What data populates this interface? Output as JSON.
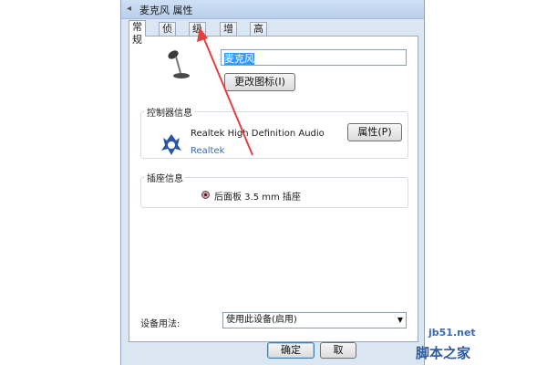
{
  "window": {
    "title": "麦克风 属性"
  },
  "tabs": [
    "常规",
    "侦听",
    "级别",
    "增强",
    "高级"
  ],
  "general": {
    "device_name": "麦克风",
    "change_icon_button": "更改图标(I)"
  },
  "controller": {
    "group_label": "控制器信息",
    "name": "Realtek High Definition Audio",
    "vendor": "Realtek",
    "properties_button": "属性(P)"
  },
  "jack": {
    "group_label": "插座信息",
    "text": "后面板 3.5 mm 插座"
  },
  "usage": {
    "label": "设备用法:",
    "selected": "使用此设备(启用)"
  },
  "buttons": {
    "ok": "确定",
    "cancel_partial": "取"
  },
  "watermark": {
    "url": "jb51.net",
    "name": "脚本之家"
  },
  "colors": {
    "annotation_arrow": "#e0403f",
    "selection": "#3399ff"
  }
}
